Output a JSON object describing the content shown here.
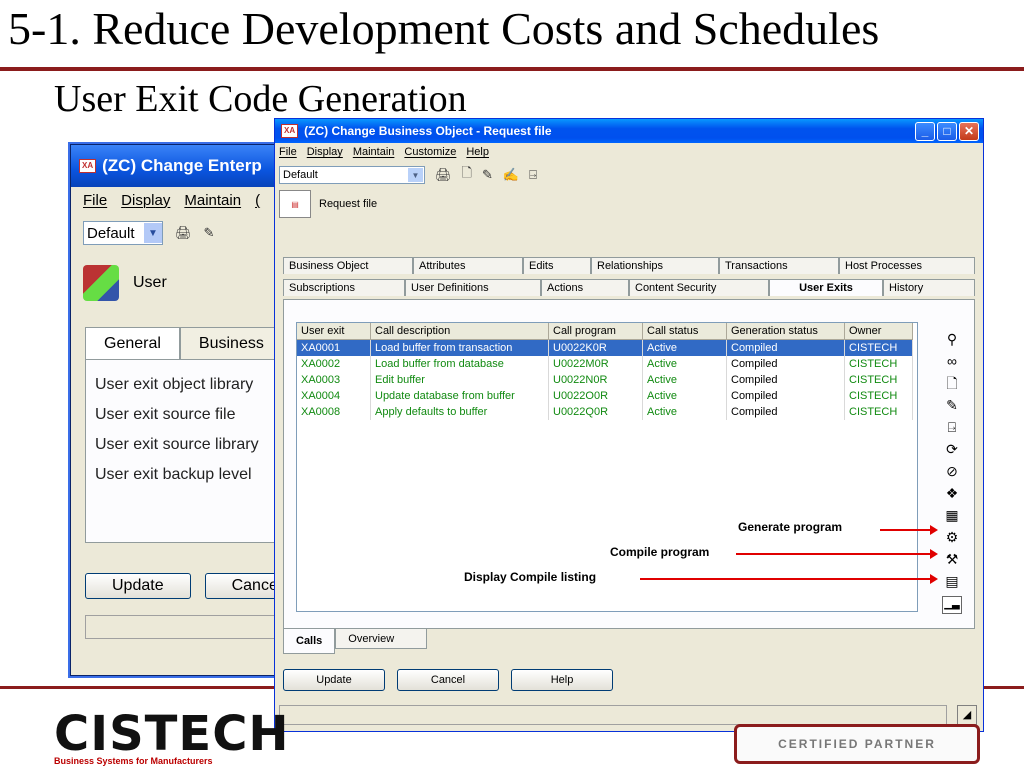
{
  "slide": {
    "title": "5-1. Reduce Development Costs and Schedules",
    "subtitle": "User Exit Code Generation"
  },
  "background_window": {
    "title": "(ZC) Change Enterp",
    "menu": [
      "File",
      "Display",
      "Maintain",
      "("
    ],
    "combo_value": "Default",
    "entity_label": "User",
    "tabs": [
      "General",
      "Business"
    ],
    "fields": [
      "User exit object library",
      "User exit source file",
      "User exit source library",
      "User exit backup level"
    ],
    "buttons": {
      "update": "Update",
      "cancel": "Cance"
    }
  },
  "window": {
    "title": "(ZC) Change Business Object - Request file",
    "menu": [
      "File",
      "Display",
      "Maintain",
      "Customize",
      "Help"
    ],
    "combo_value": "Default",
    "object_label": "Request file",
    "tabs_row1": [
      "Business Object",
      "Attributes",
      "Edits",
      "Relationships",
      "Transactions",
      "Host Processes"
    ],
    "tabs_row2": [
      "Subscriptions",
      "User Definitions",
      "Actions",
      "Content Security",
      "User Exits",
      "History"
    ],
    "grid": {
      "columns": [
        "User exit",
        "Call description",
        "Call program",
        "Call status",
        "Generation status",
        "Owner"
      ],
      "rows": [
        [
          "XA0001",
          "Load buffer from transaction",
          "U0022K0R",
          "Active",
          "Compiled",
          "CISTECH"
        ],
        [
          "XA0002",
          "Load buffer from database",
          "U0022M0R",
          "Active",
          "Compiled",
          "CISTECH"
        ],
        [
          "XA0003",
          "Edit buffer",
          "U0022N0R",
          "Active",
          "Compiled",
          "CISTECH"
        ],
        [
          "XA0004",
          "Update database from buffer",
          "U0022O0R",
          "Active",
          "Compiled",
          "CISTECH"
        ],
        [
          "XA0008",
          "Apply defaults to buffer",
          "U0022Q0R",
          "Active",
          "Compiled",
          "CISTECH"
        ]
      ]
    },
    "annotations": {
      "generate": "Generate program",
      "compile": "Compile program",
      "listing": "Display Compile listing"
    },
    "bottom_tabs": [
      "Calls",
      "Overview"
    ],
    "buttons": {
      "update": "Update",
      "cancel": "Cancel",
      "help": "Help"
    }
  },
  "logos": {
    "company": "CISTECH",
    "tagline": "Business Systems for Manufacturers",
    "partner": "CERTIFIED PARTNER"
  },
  "colors": {
    "title_rule": "#8b1c1c",
    "selection": "#316ac5",
    "active_text": "#118a11",
    "annotation_arrow": "#e00000"
  }
}
